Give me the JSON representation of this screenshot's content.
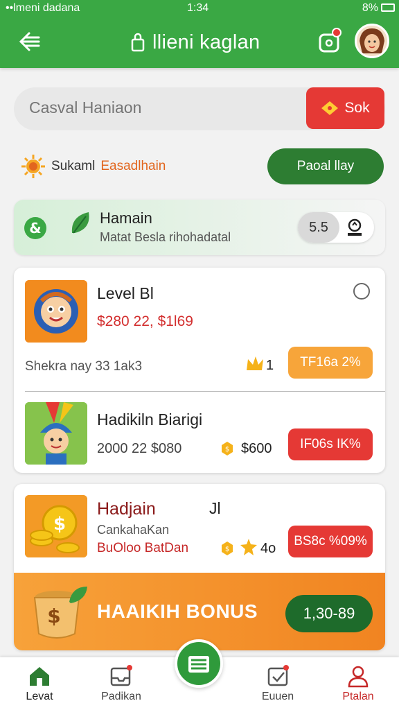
{
  "status_bar": {
    "carrier": "••lmeni dadana",
    "time": "1:34",
    "battery": "8%"
  },
  "header": {
    "title": "llieni kaglan"
  },
  "search": {
    "placeholder": "Casval Haniaon",
    "button_label": "Sok"
  },
  "promo": {
    "label_a": "Sukaml",
    "label_b": "Easadlhain",
    "play_button": "Paoal llay"
  },
  "featured": {
    "title": "Hamain",
    "subtitle": "Matat Besla rihohadatal",
    "rating": "5.5"
  },
  "cards": [
    {
      "title": "Level Bl",
      "price": "$280 22, $1l69",
      "meta": "Shekra nay 33 1ak3",
      "count": "1",
      "badge": "TF16a 2%"
    },
    {
      "title": "Hadikiln Biarigi",
      "price": "2000 22 $080",
      "amount": "$600",
      "badge": "IF06s IK%"
    },
    {
      "title": "Hadjain",
      "suffix": "Jl",
      "sub1": "CankahaKan",
      "sub2": "BuOloo BatDan",
      "count": "4o",
      "badge": "BS8c %09%"
    }
  ],
  "bonus": {
    "label": "HAAIKIH BONUS",
    "button": "1,30-89"
  },
  "nav": {
    "items": [
      "Levat",
      "Padikan",
      "Euuen",
      "Ptalan"
    ]
  },
  "colors": {
    "green": "#3aa844",
    "dark_green": "#2d7d32",
    "red": "#e53935",
    "orange": "#f7a23a"
  }
}
